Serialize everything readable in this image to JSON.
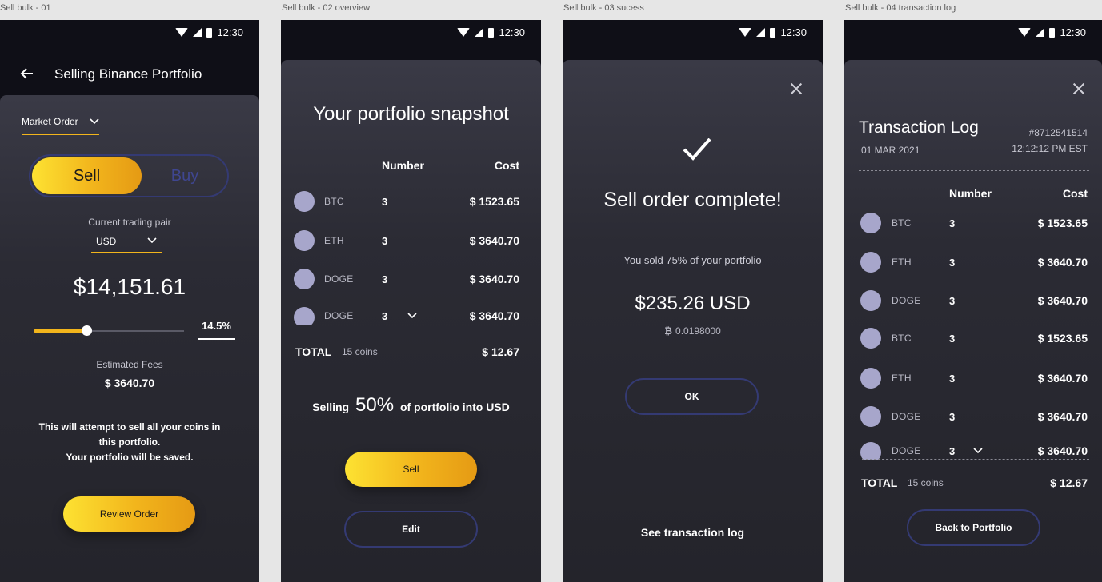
{
  "frames": [
    {
      "label": "Sell bulk - 01"
    },
    {
      "label": "Sell bulk - 02 overview"
    },
    {
      "label": "Sell bulk - 03 sucess"
    },
    {
      "label": "Sell bulk - 04 transaction log"
    }
  ],
  "status_time": "12:30",
  "screen1": {
    "title": "Selling Binance Portfolio",
    "order_type": "Market Order",
    "toggle": {
      "sell": "Sell",
      "buy": "Buy",
      "selected": "Sell"
    },
    "pair_label": "Current trading pair",
    "pair_value": "USD",
    "amount": "$14,151.61",
    "slider_percent": "14.5%",
    "slider_fraction": 0.35,
    "fees_label": "Estimated Fees",
    "fees_value": "$ 3640.70",
    "warning_line1": "This will attempt to sell all your coins in",
    "warning_line2": "this portfolio.",
    "warning_line3": "Your portfolio will be saved.",
    "review_button": "Review Order"
  },
  "screen2": {
    "heading": "Your portfolio snapshot",
    "col_number": "Number",
    "col_cost": "Cost",
    "rows": [
      {
        "symbol": "BTC",
        "number": "3",
        "cost": "$ 1523.65"
      },
      {
        "symbol": "ETH",
        "number": "3",
        "cost": "$ 3640.70"
      },
      {
        "symbol": "DOGE",
        "number": "3",
        "cost": "$ 3640.70"
      },
      {
        "symbol": "DOGE",
        "number": "3",
        "cost": "$ 3640.70"
      }
    ],
    "total_label": "TOTAL",
    "total_coins": "15 coins",
    "total_value": "$ 12.67",
    "selling_prefix": "Selling",
    "selling_percent": "50%",
    "selling_suffix": "of portfolio into USD",
    "sell_button": "Sell",
    "edit_button": "Edit"
  },
  "screen3": {
    "heading": "Sell order complete!",
    "sold_text": "You sold 75% of your portfolio",
    "amount": "$235.26 USD",
    "btc_amount": "0.0198000",
    "ok_button": "OK",
    "log_link": "See transaction log"
  },
  "screen4": {
    "heading": "Transaction Log",
    "tx_id": "#8712541514",
    "date": "01 MAR 2021",
    "time": "12:12:12 PM EST",
    "col_number": "Number",
    "col_cost": "Cost",
    "rows": [
      {
        "symbol": "BTC",
        "number": "3",
        "cost": "$ 1523.65"
      },
      {
        "symbol": "ETH",
        "number": "3",
        "cost": "$ 3640.70"
      },
      {
        "symbol": "DOGE",
        "number": "3",
        "cost": "$ 3640.70"
      },
      {
        "symbol": "BTC",
        "number": "3",
        "cost": "$ 1523.65"
      },
      {
        "symbol": "ETH",
        "number": "3",
        "cost": "$ 3640.70"
      },
      {
        "symbol": "DOGE",
        "number": "3",
        "cost": "$ 3640.70"
      },
      {
        "symbol": "DOGE",
        "number": "3",
        "cost": "$ 3640.70"
      }
    ],
    "total_label": "TOTAL",
    "total_coins": "15 coins",
    "total_value": "$ 12.67",
    "back_button": "Back to Portfolio"
  },
  "colors": {
    "background": "#0f0f17",
    "sheet": "#2b2b34",
    "accent_gold": "#f2b51c",
    "outline_blue": "#343a73",
    "coin_dot": "#a7a6cb"
  }
}
